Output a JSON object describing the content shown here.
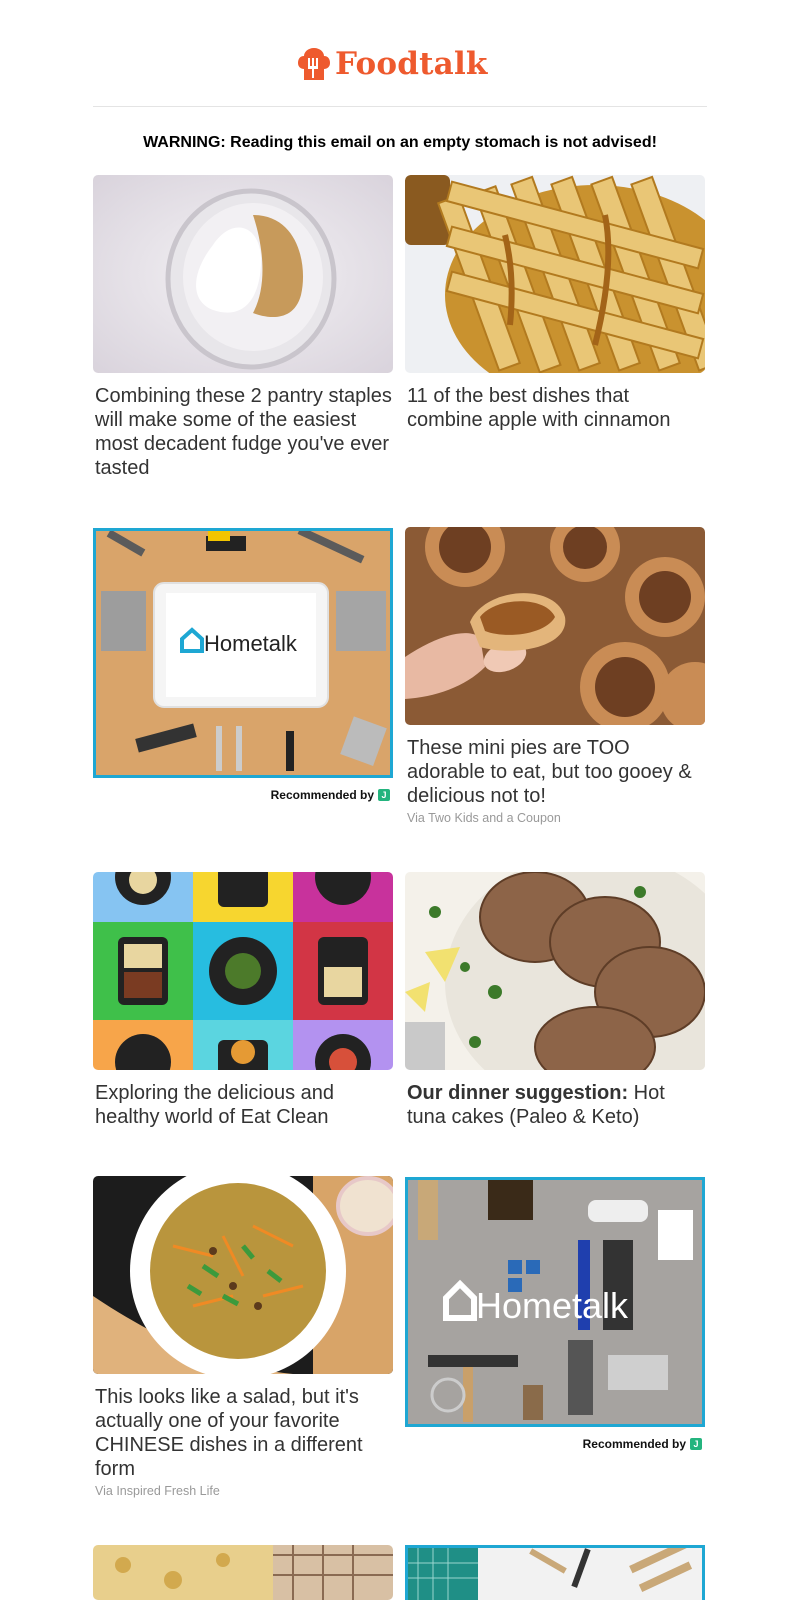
{
  "brand": {
    "name": "Foodtalk",
    "color": "#ee5a2e"
  },
  "warning": "WARNING: Reading this email on an empty stomach is not advised!",
  "accent_ad_border": "#1ea7d3",
  "cards": [
    {
      "title": "Combining these 2 pantry staples will make some of the easiest most decadent fudge you've ever tasted",
      "image": "bowl of powdered sugar and peanut butter"
    },
    {
      "title": "11 of the best dishes that combine apple with cinnamon",
      "image": "lattice apple pie with caramel"
    },
    {
      "ad_brand": "Hometalk",
      "recommended": "Recommended by",
      "image": "tablet surrounded by tools"
    },
    {
      "title": "These mini pies are TOO adorable to eat, but too gooey & delicious not to!",
      "via": "Via Two Kids and a Coupon",
      "image": "mini pecan pie in hand"
    },
    {
      "title": "Exploring the delicious and healthy world of Eat Clean",
      "image": "meal containers on colorful grid"
    },
    {
      "title_bold": "Our dinner suggestion:",
      "title_rest": " Hot tuna cakes (Paleo & Keto)",
      "image": "tuna cakes with lemon and cilantro"
    },
    {
      "title": "This looks like a salad, but it's actually one of your favorite CHINESE dishes in a different form",
      "via": "Via Inspired Fresh Life",
      "image": "bowl of stir fried cabbage with scallions"
    },
    {
      "ad_brand": "Hometalk",
      "recommended": "Recommended by",
      "image": "paint tools flat lay"
    }
  ]
}
